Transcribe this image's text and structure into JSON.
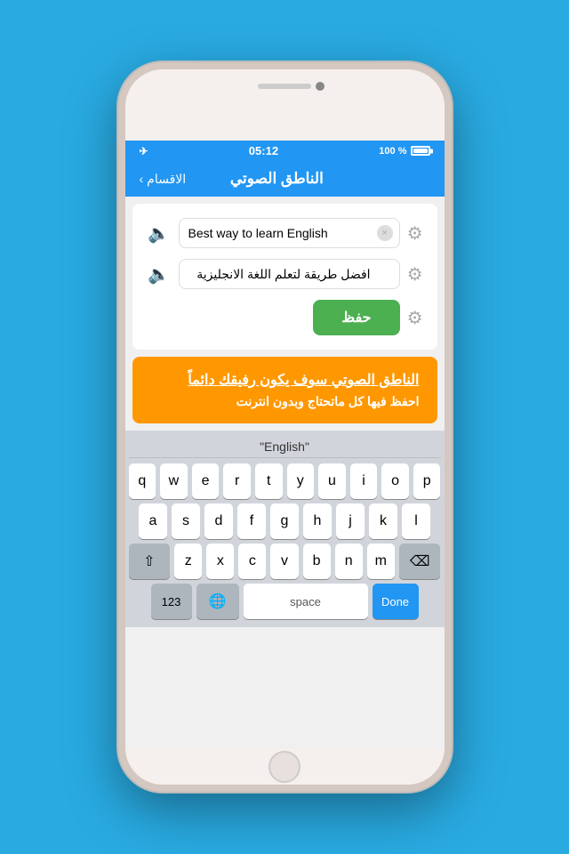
{
  "status_bar": {
    "time": "05:12",
    "battery_text": "100 %",
    "airplane_icon": "✈"
  },
  "nav": {
    "back_label": "الاقسام",
    "title": "الناطق الصوتي",
    "back_arrow": "‹"
  },
  "inputs": {
    "row1_value": "Best way to learn English",
    "row2_value": "افضل طريقة لتعلم اللغة الانجليزية",
    "row2_placeholder": "افضل طريقة لتعلم اللغة الانجليزية"
  },
  "buttons": {
    "save_label": "حفظ",
    "clear_icon": "×"
  },
  "banner": {
    "title": "الناطق الصوتي سوف يكون رفيقك دائماً",
    "subtitle": "احفظ فيها كل ماتحتاج وبدون انترنت"
  },
  "keyboard": {
    "suggestion": "\"English\"",
    "rows": [
      [
        "q",
        "w",
        "e",
        "r",
        "t",
        "y",
        "u",
        "i",
        "o",
        "p"
      ],
      [
        "a",
        "s",
        "d",
        "f",
        "g",
        "h",
        "j",
        "k",
        "l"
      ],
      [
        "z",
        "x",
        "c",
        "v",
        "b",
        "n",
        "m"
      ]
    ],
    "space_label": "space",
    "done_label": "Done",
    "num_label": "123",
    "globe_icon": "🌐",
    "shift_icon": "⇧",
    "backspace_icon": "⌫"
  },
  "icons": {
    "speaker": "🔈",
    "gear": "⚙"
  }
}
